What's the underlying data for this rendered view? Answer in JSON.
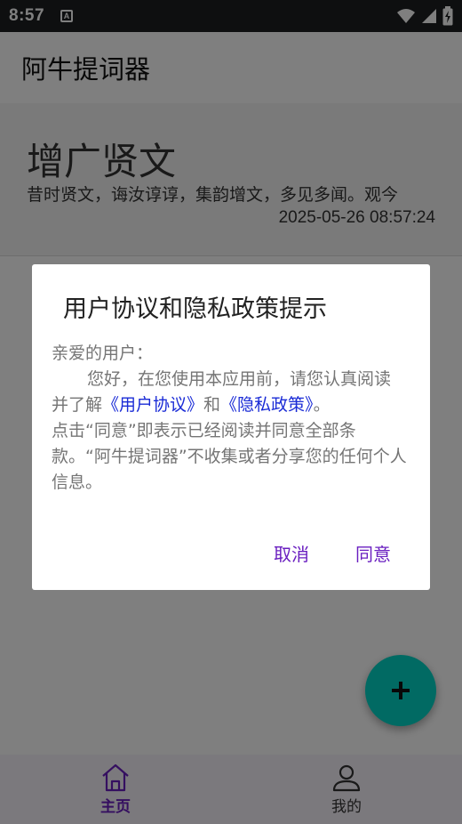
{
  "status_bar": {
    "time": "8:57",
    "notification_letter": "A"
  },
  "app_bar": {
    "title": "阿牛提词器"
  },
  "article_card": {
    "title": "增广贤文",
    "excerpt": "昔时贤文，诲汝谆谆，集韵增文，多见多闻。观今",
    "date": "2025-05-26 08:57:24"
  },
  "bottom_nav": {
    "items": [
      {
        "label": "主页",
        "icon": "home-icon",
        "active": true
      },
      {
        "label": "我的",
        "icon": "person-icon",
        "active": false
      }
    ]
  },
  "fab": {
    "icon": "plus-icon"
  },
  "dialog": {
    "title": "用户协议和隐私政策提示",
    "greeting": "亲爱的用户：",
    "para1_a": "您好，在您使用本应用前，请您认真阅读并了解",
    "user_agreement_link": "《用户协议》",
    "and": "和",
    "privacy_policy_link": "《隐私政策》",
    "period": "。",
    "para2": "点击“同意”即表示已经阅读并同意全部条款。“阿牛提词器”不收集或者分享您的任何个人信息。",
    "cancel_label": "取消",
    "agree_label": "同意"
  },
  "colors": {
    "accent": "#6a1fc0",
    "fab": "#03d5c6",
    "link": "#1a2bd6",
    "status_bar": "#1c1f20"
  }
}
